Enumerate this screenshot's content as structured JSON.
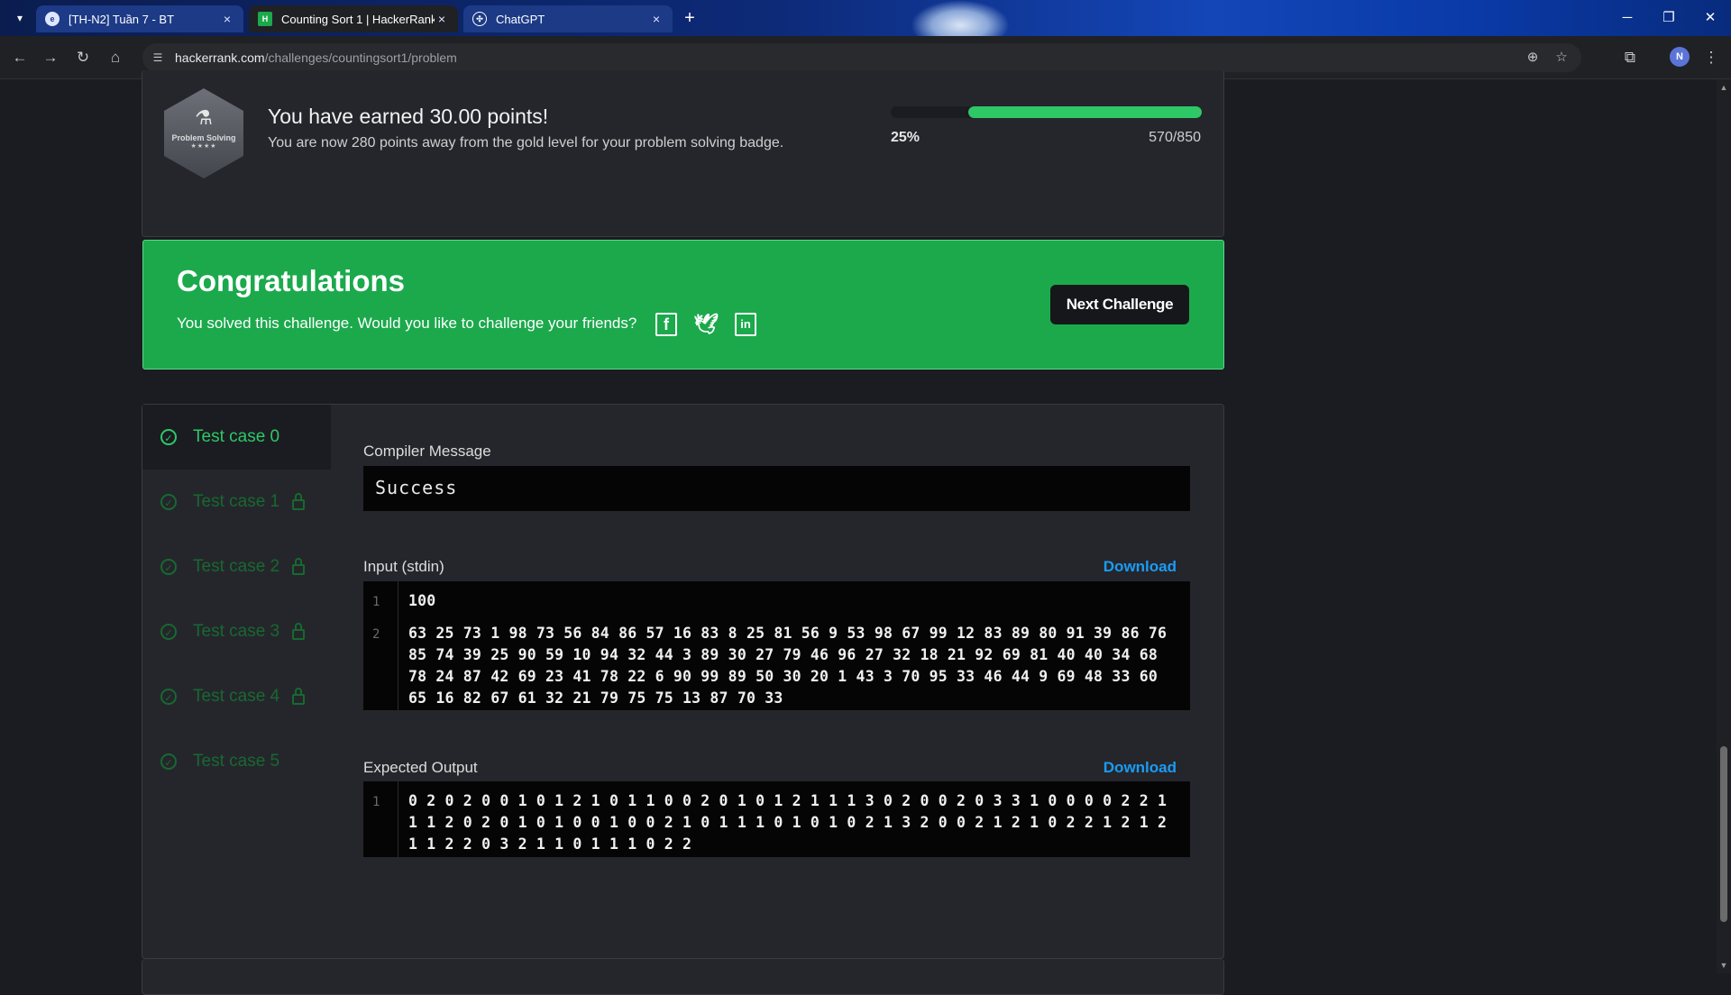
{
  "browser": {
    "tabs": [
      {
        "title": "[TH-N2] Tuần 7 - BT",
        "close": "×"
      },
      {
        "title": "Counting Sort 1 | HackerRank",
        "close": "×"
      },
      {
        "title": "ChatGPT",
        "close": "×"
      }
    ],
    "new_tab": "+",
    "url_host": "hackerrank.com",
    "url_path": "/challenges/countingsort1/problem",
    "profile_initial": "N"
  },
  "points": {
    "title": "You have earned 30.00 points!",
    "subtitle": "You are now 280 points away from the gold level for your problem solving badge.",
    "badge_label": "Problem Solving",
    "badge_stars": "★★★★",
    "progress_percent_label": "25%",
    "progress_fraction": "570/850",
    "progress_value": 0.75
  },
  "congrats": {
    "title": "Congratulations",
    "message": "You solved this challenge. Would you like to challenge your friends?",
    "next_button": "Next Challenge"
  },
  "test_cases": [
    {
      "label": "Test case 0",
      "locked": false
    },
    {
      "label": "Test case 1",
      "locked": true
    },
    {
      "label": "Test case 2",
      "locked": true
    },
    {
      "label": "Test case 3",
      "locked": true
    },
    {
      "label": "Test case 4",
      "locked": true
    },
    {
      "label": "Test case 5",
      "locked": false
    }
  ],
  "compiler": {
    "label": "Compiler Message",
    "message": "Success"
  },
  "input": {
    "label": "Input (stdin)",
    "download": "Download",
    "line_numbers": [
      "1",
      "2"
    ],
    "lines": [
      "100",
      "63 25 73 1 98 73 56 84 86 57 16 83 8 25 81 56 9 53 98 67 99 12 83 89 80 91 39 86 76 85 74 39 25 90 59 10 94 32 44 3 89 30 27 79 46 96 27 32 18 21 92 69 81 40 40 34 68 78 24 87 42 69 23 41 78 22 6 90 99 89 50 30 20 1 43 3 70 95 33 46 44 9 69 48 33 60 65 16 82 67 61 32 21 79 75 75 13 87 70 33"
    ]
  },
  "expected": {
    "label": "Expected Output",
    "download": "Download",
    "line_numbers": [
      "1"
    ],
    "lines": [
      "0 2 0 2 0 0 1 0 1 2 1 0 1 1 0 0 2 0 1 0 1 2 1 1 1 3 0 2 0 0 2 0 3 3 1 0 0 0 0 2 2 1 1 1 2 0 2 0 1 0 1 0 0 1 0 0 2 1 0 1 1 1 0 1 0 1 0 2 1 3 2 0 0 2 1 2 1 0 2 2 1 2 1 2 1 1 2 2 0 3 2 1 1 0 1 1 1 0 2 2"
    ]
  },
  "colors": {
    "accent_green": "#2ec866",
    "banner_green": "#1ba94c",
    "link_blue": "#1a9cf4"
  }
}
